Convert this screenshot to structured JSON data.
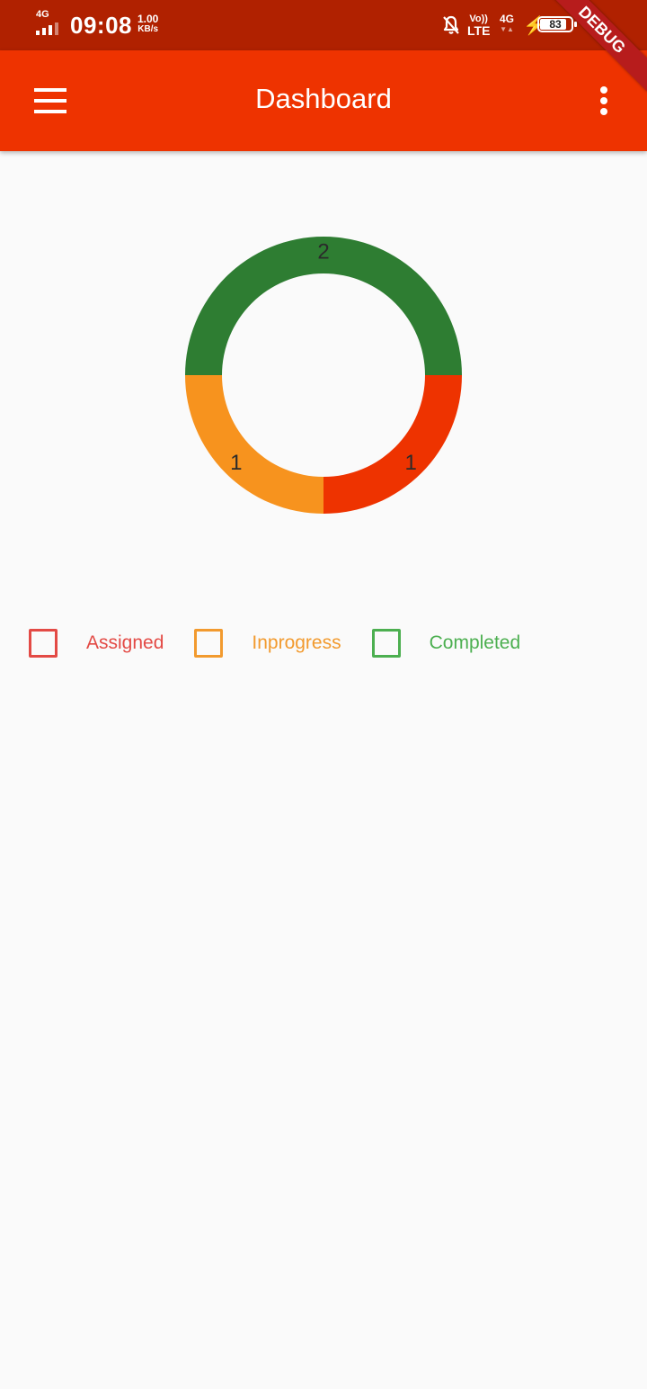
{
  "status_bar": {
    "network_type": "4G",
    "time": "09:08",
    "speed_value": "1.00",
    "speed_unit": "KB/s",
    "volte_top": "Vo))",
    "volte_bottom": "LTE",
    "data_type": "4G",
    "data_arrows": "▼▲",
    "battery": "83"
  },
  "debug_banner": "DEBUG",
  "app_bar": {
    "title": "Dashboard",
    "menu_icon": "hamburger-menu-icon",
    "more_icon": "more-vertical-icon"
  },
  "chart_data": {
    "type": "pie",
    "style": "donut",
    "labels": [
      "Assigned",
      "Inprogress",
      "Completed"
    ],
    "values": [
      1,
      1,
      2
    ],
    "colors": [
      "#ee3300",
      "#f7931e",
      "#2e7d32"
    ],
    "legend_colors": [
      "#e34a45",
      "#f29a2e",
      "#4caf50"
    ],
    "legend_position": "bottom-left",
    "data_labels_shown": true
  }
}
